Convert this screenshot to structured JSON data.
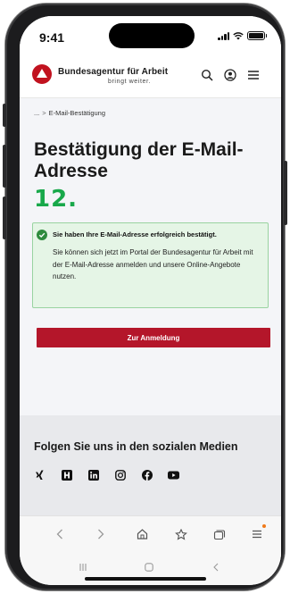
{
  "status_bar": {
    "time": "9:41"
  },
  "header": {
    "brand_name": "Bundesagentur für Arbeit",
    "brand_tagline": "bringt weiter.",
    "icons": [
      "search-icon",
      "account-icon",
      "menu-icon"
    ]
  },
  "breadcrumb": {
    "ellipsis": "...",
    "separator": ">",
    "current": "E-Mail-Bestätigung"
  },
  "page": {
    "title": "Bestätigung der E-Mail-Adresse",
    "step_label": "12."
  },
  "alert": {
    "heading": "Sie haben Ihre E-Mail-Adresse erfolgreich bestätigt.",
    "body": "Sie können sich jetzt im Portal der Bundesagentur für Arbeit mit der E-Mail-Adresse anmelden und unsere Online-Angebote nutzen."
  },
  "primary_button": {
    "label": "Zur Anmeldung"
  },
  "social": {
    "heading": "Folgen Sie uns in den sozialen Medien",
    "icons": [
      "xing-icon",
      "kununu-icon",
      "linkedin-icon",
      "instagram-icon",
      "facebook-icon",
      "youtube-icon"
    ]
  },
  "colors": {
    "brand_red": "#c1121f",
    "button_red": "#b4162a",
    "success_green": "#2e8b3d",
    "step_green": "#18a84a",
    "alert_bg": "#e5f5e6"
  }
}
